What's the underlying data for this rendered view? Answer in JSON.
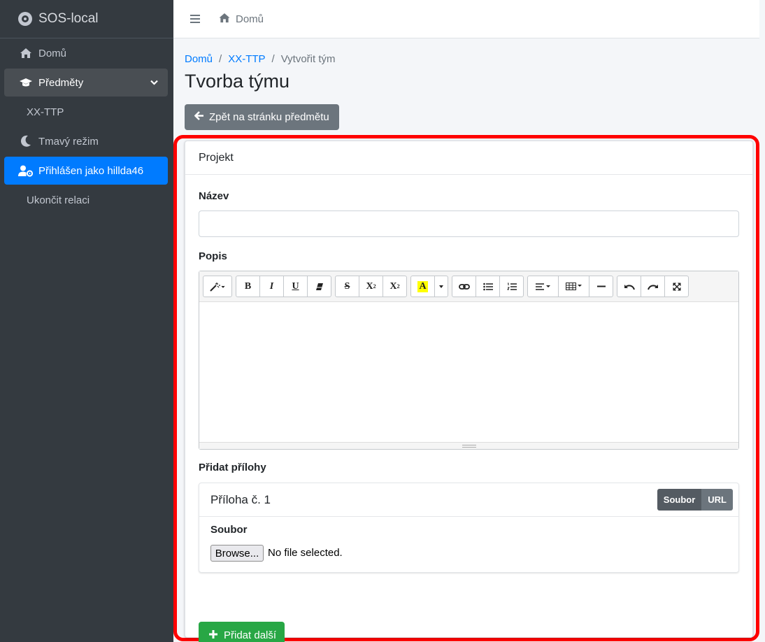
{
  "sidebar": {
    "brand": "SOS-local",
    "items": [
      {
        "label": "Domů",
        "icon": "home-icon"
      },
      {
        "label": "Předměty",
        "icon": "graduation-cap-icon"
      },
      {
        "label": "XX-TTP"
      },
      {
        "label": "Tmavý režim",
        "icon": "moon-icon"
      },
      {
        "label": "Přihlášen jako hillda46",
        "icon": "user-cog-icon"
      },
      {
        "label": "Ukončit relaci"
      }
    ]
  },
  "topbar": {
    "home_label": "Domů"
  },
  "breadcrumb": {
    "home": "Domů",
    "subject": "XX-TTP",
    "current": "Vytvořit tým",
    "separator": "/"
  },
  "page": {
    "title": "Tvorba týmu",
    "back_label": "Zpět na stránku předmětu"
  },
  "form": {
    "card_title": "Projekt",
    "name_label": "Název",
    "name_value": "",
    "description_label": "Popis",
    "attachments_label": "Přidat přílohy",
    "attachment": {
      "title": "Příloha č. 1",
      "mode_file": "Soubor",
      "mode_url": "URL",
      "file_label": "Soubor",
      "browse_label": "Browse...",
      "no_file": "No file selected."
    },
    "add_more_label": "Přidat další"
  },
  "colors": {
    "sidebar_bg": "#343a40",
    "accent": "#007bff",
    "success": "#28a745",
    "secondary": "#6c757d",
    "highlight": "#ff0000"
  }
}
